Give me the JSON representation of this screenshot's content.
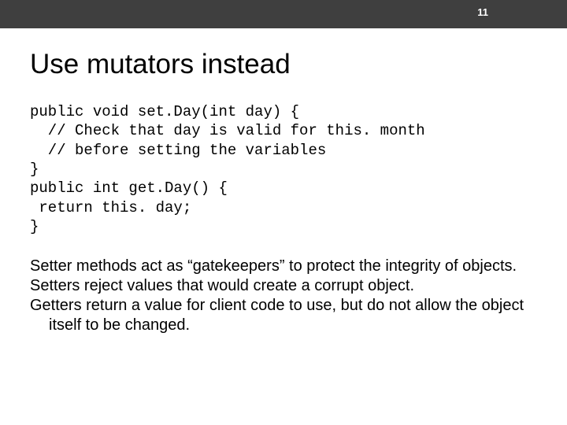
{
  "page_number": "11",
  "title": "Use mutators instead",
  "code": "public void set.Day(int day) {\n  // Check that day is valid for this. month\n  // before setting the variables\n}\npublic int get.Day() {\n return this. day;\n}",
  "paragraphs": [
    "Setter methods act as “gatekeepers” to protect the integrity of objects.",
    "Setters reject values that would create a corrupt object.",
    "Getters return a value for client code to use, but do not allow the object itself to be changed."
  ]
}
